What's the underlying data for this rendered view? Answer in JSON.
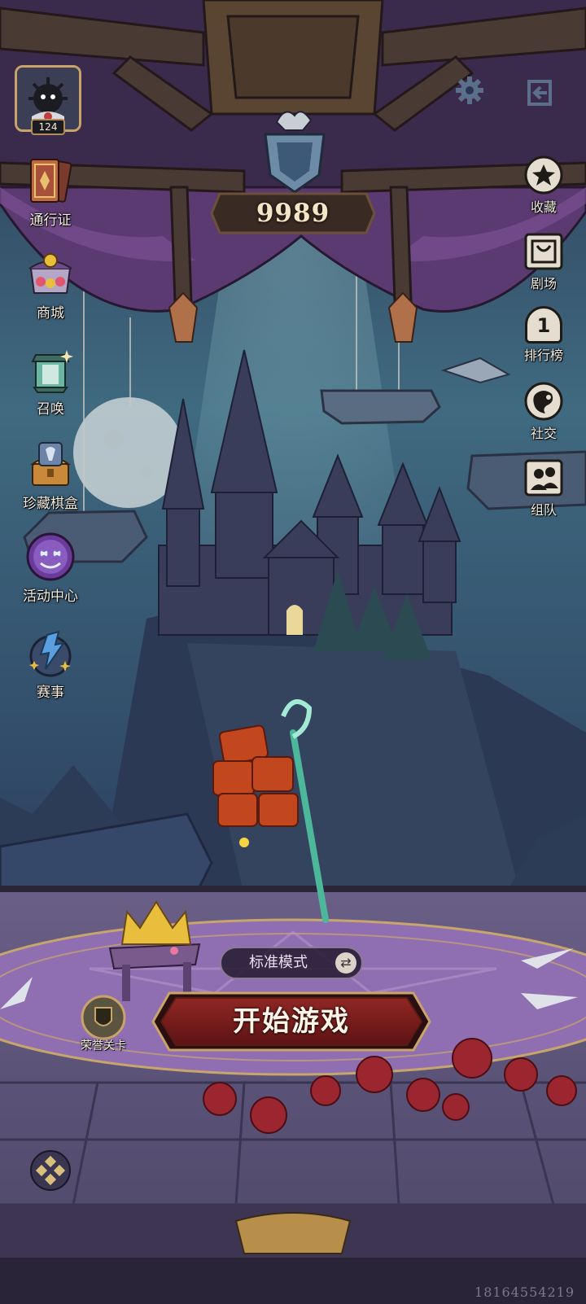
{
  "player": {
    "level": "124"
  },
  "top_icons": {
    "settings": "gear-icon",
    "logout": "exit-icon"
  },
  "currency": {
    "value": "9989"
  },
  "left_menu": [
    {
      "label": "通行证",
      "icon": "pass-card-icon"
    },
    {
      "label": "商城",
      "icon": "shop-icon"
    },
    {
      "label": "召唤",
      "icon": "summon-lantern-icon"
    },
    {
      "label": "珍藏棋盒",
      "icon": "treasure-box-icon"
    },
    {
      "label": "活动中心",
      "icon": "event-mask-icon"
    },
    {
      "label": "赛事",
      "icon": "tournament-icon"
    }
  ],
  "right_menu": [
    {
      "label": "收藏",
      "icon": "star-collection-icon"
    },
    {
      "label": "剧场",
      "icon": "theater-icon"
    },
    {
      "label": "排行榜",
      "icon": "ranking-icon",
      "rank_number": "1"
    },
    {
      "label": "社交",
      "icon": "social-icon"
    },
    {
      "label": "组队",
      "icon": "team-icon"
    }
  ],
  "game_mode": {
    "label": "标准模式"
  },
  "start_button": {
    "label": "开始游戏"
  },
  "honor_level": {
    "label": "荣誉关卡"
  },
  "watermark": "18164554219",
  "colors": {
    "start_button_red": "#7b1d1c",
    "gold_trim": "#c9a36a",
    "night_sky": "#3b5e78",
    "floor_purple": "#8a6aa8"
  }
}
